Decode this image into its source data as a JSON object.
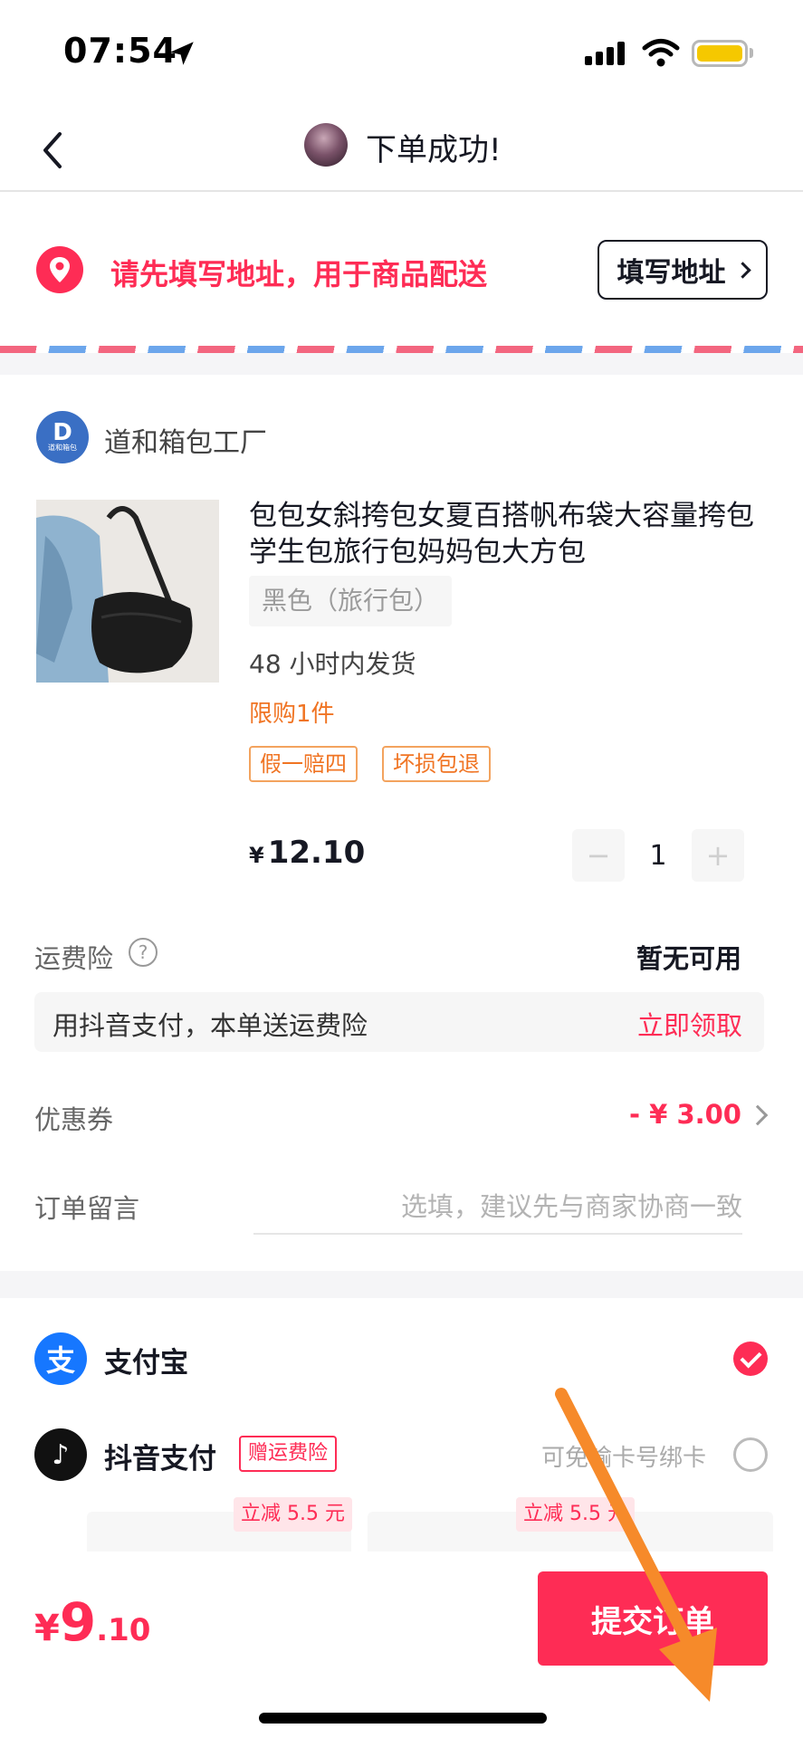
{
  "status_bar": {
    "time": "07:54"
  },
  "nav": {
    "title": "下单成功!"
  },
  "address": {
    "prompt": "请先填写地址，用于商品配送",
    "button_label": "填写地址"
  },
  "shop": {
    "name": "道和箱包工厂",
    "logo_letter": "D",
    "logo_sub": "道和箱包"
  },
  "product": {
    "title": "包包女斜挎包女夏百搭帆布袋大容量挎包学生包旅行包妈妈包大方包",
    "sku": "黑色（旅行包）",
    "shipping": "48 小时内发货",
    "limit": "限购1件",
    "tags": [
      "假一赔四",
      "坏损包退"
    ],
    "price_symbol": "¥",
    "price": "12.10",
    "quantity": "1",
    "minus": "−",
    "plus": "+"
  },
  "insurance": {
    "label": "运费险",
    "help": "?",
    "value": "暂无可用",
    "promo_text": "用抖音支付，本单送运费险",
    "promo_action": "立即领取"
  },
  "coupon": {
    "label": "优惠券",
    "value": "- ¥ 3.00"
  },
  "note": {
    "label": "订单留言",
    "placeholder": "选填，建议先与商家协商一致"
  },
  "payment": {
    "alipay": {
      "label": "支付宝",
      "icon_text": "支",
      "selected": true
    },
    "douyin": {
      "label": "抖音支付",
      "icon_text": "♪",
      "badge": "赠运费险",
      "hint": "可免输卡号绑卡",
      "selected": false
    },
    "card_offers": [
      "立减 5.5 元",
      "立减 5.5 元"
    ]
  },
  "total": {
    "symbol": "¥",
    "integer": "9",
    "decimal": ".10"
  },
  "submit_label": "提交订单",
  "colors": {
    "accent": "#fe2c55",
    "orange": "#f07423",
    "alipay": "#1677ff"
  }
}
